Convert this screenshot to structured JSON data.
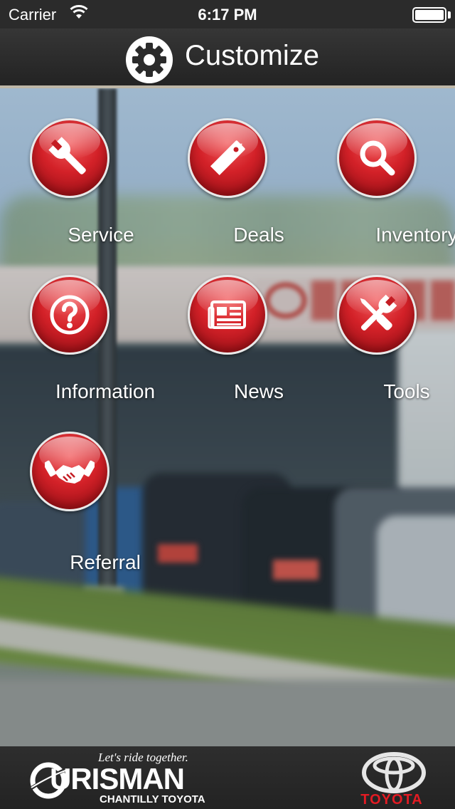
{
  "status_bar": {
    "carrier": "Carrier",
    "time": "6:17 PM",
    "battery_level": 1.0
  },
  "header": {
    "title": "Customize",
    "icon": "gear-icon"
  },
  "menu": {
    "items": [
      {
        "label": "Service",
        "icon": "wrench-icon"
      },
      {
        "label": "Deals",
        "icon": "price-tag-icon"
      },
      {
        "label": "Inventory",
        "icon": "search-icon"
      },
      {
        "label": "Information",
        "icon": "question-icon"
      },
      {
        "label": "News",
        "icon": "newspaper-icon"
      },
      {
        "label": "Tools",
        "icon": "tools-icon"
      },
      {
        "label": "Referral",
        "icon": "handshake-icon"
      }
    ],
    "button_color": "#d32128"
  },
  "footer": {
    "slogan": "Let's ride together.",
    "dealer_name": "URISMAN",
    "dealer_subname": "CHANTILLY TOYOTA",
    "brand_name": "TOYOTA",
    "brand_color": "#e31b23"
  }
}
